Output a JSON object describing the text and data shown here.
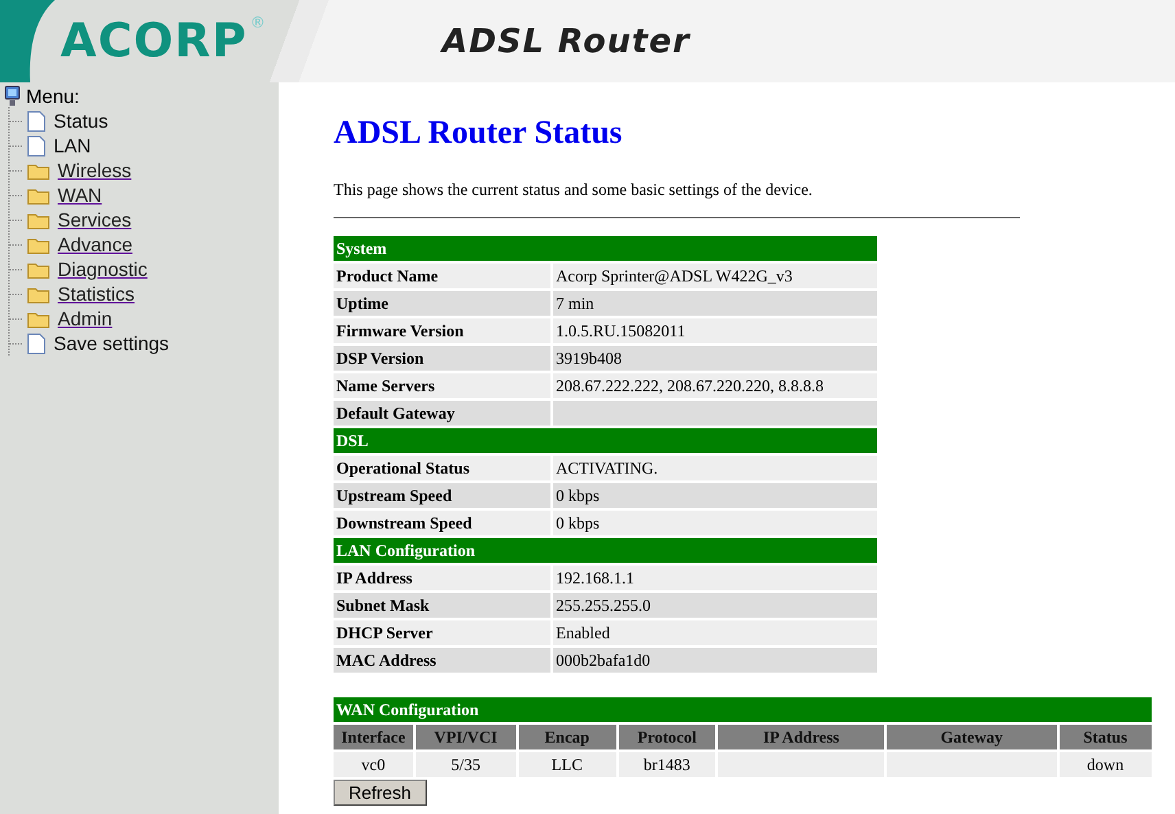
{
  "header": {
    "logo": "ACORP",
    "logo_mark": "®",
    "title": "ADSL Router"
  },
  "sidebar": {
    "title": "Menu:",
    "items": [
      {
        "label": "Status",
        "kind": "page"
      },
      {
        "label": "LAN",
        "kind": "page"
      },
      {
        "label": "Wireless",
        "kind": "folder"
      },
      {
        "label": "WAN",
        "kind": "folder"
      },
      {
        "label": "Services",
        "kind": "folder"
      },
      {
        "label": "Advance",
        "kind": "folder"
      },
      {
        "label": "Diagnostic",
        "kind": "folder"
      },
      {
        "label": "Statistics",
        "kind": "folder"
      },
      {
        "label": "Admin",
        "kind": "folder"
      },
      {
        "label": "Save settings",
        "kind": "page"
      }
    ]
  },
  "page": {
    "title": "ADSL Router Status",
    "description": "This page shows the current status and some basic settings of the device."
  },
  "status_table": {
    "sections": [
      {
        "title": "System",
        "rows": [
          [
            "Product Name",
            "Acorp Sprinter@ADSL W422G_v3"
          ],
          [
            "Uptime",
            "7 min"
          ],
          [
            "Firmware Version",
            "1.0.5.RU.15082011"
          ],
          [
            "DSP Version",
            "3919b408"
          ],
          [
            "Name Servers",
            "208.67.222.222, 208.67.220.220, 8.8.8.8"
          ],
          [
            "Default Gateway",
            ""
          ]
        ]
      },
      {
        "title": "DSL",
        "rows": [
          [
            "Operational Status",
            "ACTIVATING."
          ],
          [
            "Upstream Speed",
            "0 kbps"
          ],
          [
            "Downstream Speed",
            "0 kbps"
          ]
        ]
      },
      {
        "title": "LAN Configuration",
        "rows": [
          [
            "IP Address",
            "192.168.1.1"
          ],
          [
            "Subnet Mask",
            "255.255.255.0"
          ],
          [
            "DHCP Server",
            "Enabled"
          ],
          [
            "MAC Address",
            "000b2bafa1d0"
          ]
        ]
      }
    ]
  },
  "wan_table": {
    "title": "WAN Configuration",
    "columns": [
      "Interface",
      "VPI/VCI",
      "Encap",
      "Protocol",
      "IP Address",
      "Gateway",
      "Status"
    ],
    "rows": [
      [
        "vc0",
        "5/35",
        "LLC",
        "br1483",
        "",
        "",
        "down"
      ]
    ]
  },
  "buttons": [
    "Refresh"
  ]
}
